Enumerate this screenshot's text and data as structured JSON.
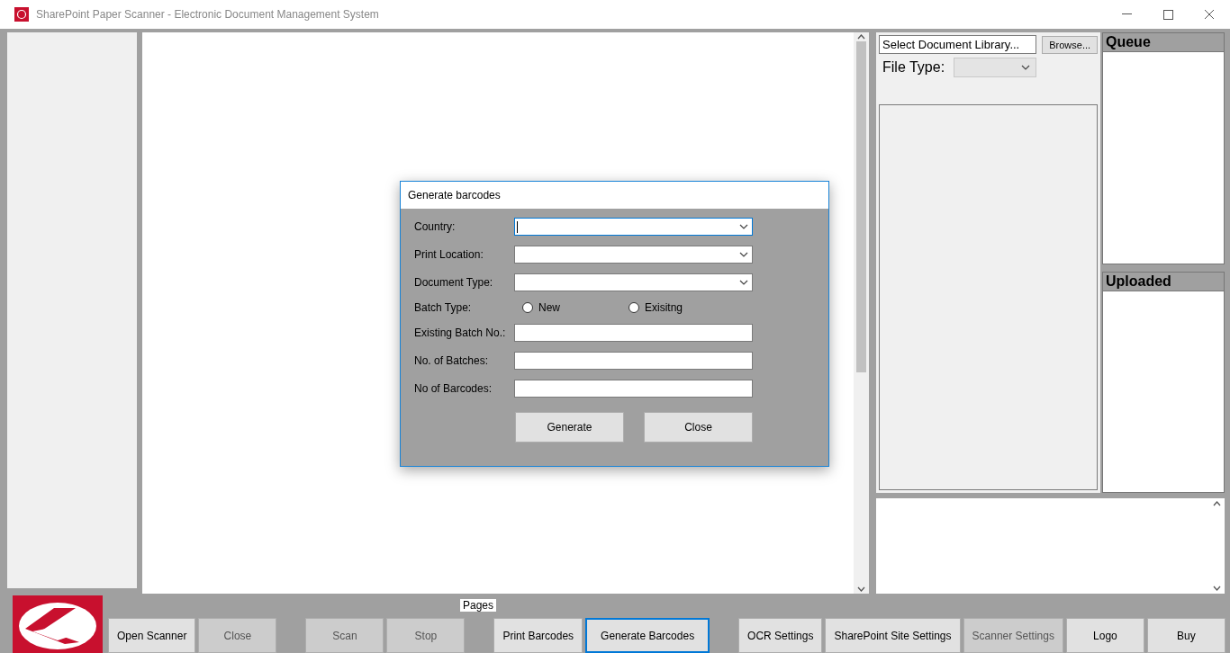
{
  "window": {
    "title": "SharePoint Paper Scanner - Electronic Document Management System"
  },
  "library": {
    "field": "Select Document Library...",
    "browse": "Browse...",
    "file_type_label": "File Type:"
  },
  "queue": {
    "title": "Queue"
  },
  "uploaded": {
    "title": "Uploaded"
  },
  "pages_label": "Pages",
  "toolbar_groups": [
    {
      "buttons": [
        {
          "label": "Open Scanner",
          "disabled": false,
          "focused": false
        },
        {
          "label": "Close",
          "disabled": true,
          "focused": false
        }
      ]
    },
    {
      "buttons": [
        {
          "label": "Scan",
          "disabled": true,
          "focused": false
        },
        {
          "label": "Stop",
          "disabled": true,
          "focused": false
        }
      ]
    },
    {
      "buttons": [
        {
          "label": "Print Barcodes",
          "disabled": false,
          "focused": false
        },
        {
          "label": "Generate Barcodes",
          "disabled": false,
          "focused": true
        }
      ]
    },
    {
      "buttons": [
        {
          "label": "OCR Settings",
          "disabled": false,
          "focused": false
        },
        {
          "label": "SharePoint Site Settings",
          "disabled": false,
          "focused": false
        },
        {
          "label": "Scanner Settings",
          "disabled": true,
          "focused": false
        },
        {
          "label": "Logo",
          "disabled": false,
          "focused": false
        },
        {
          "label": "Buy",
          "disabled": false,
          "focused": false
        }
      ]
    }
  ],
  "dialog": {
    "title": "Generate barcodes",
    "fields": [
      {
        "kind": "combo",
        "label": "Country:",
        "focused": true
      },
      {
        "kind": "combo",
        "label": "Print Location:",
        "focused": false
      },
      {
        "kind": "combo",
        "label": "Document Type:",
        "focused": false
      },
      {
        "kind": "radio",
        "label": "Batch Type:",
        "options": [
          {
            "label": "New",
            "selected": false
          },
          {
            "label": "Exisitng",
            "selected": false
          }
        ]
      },
      {
        "kind": "text",
        "label": "Existing Batch No.:",
        "focused": false
      },
      {
        "kind": "text",
        "label": "No. of Batches:",
        "focused": false
      },
      {
        "kind": "text",
        "label": "No of Barcodes:",
        "focused": false
      }
    ],
    "buttons": [
      "Generate",
      "Close"
    ]
  }
}
